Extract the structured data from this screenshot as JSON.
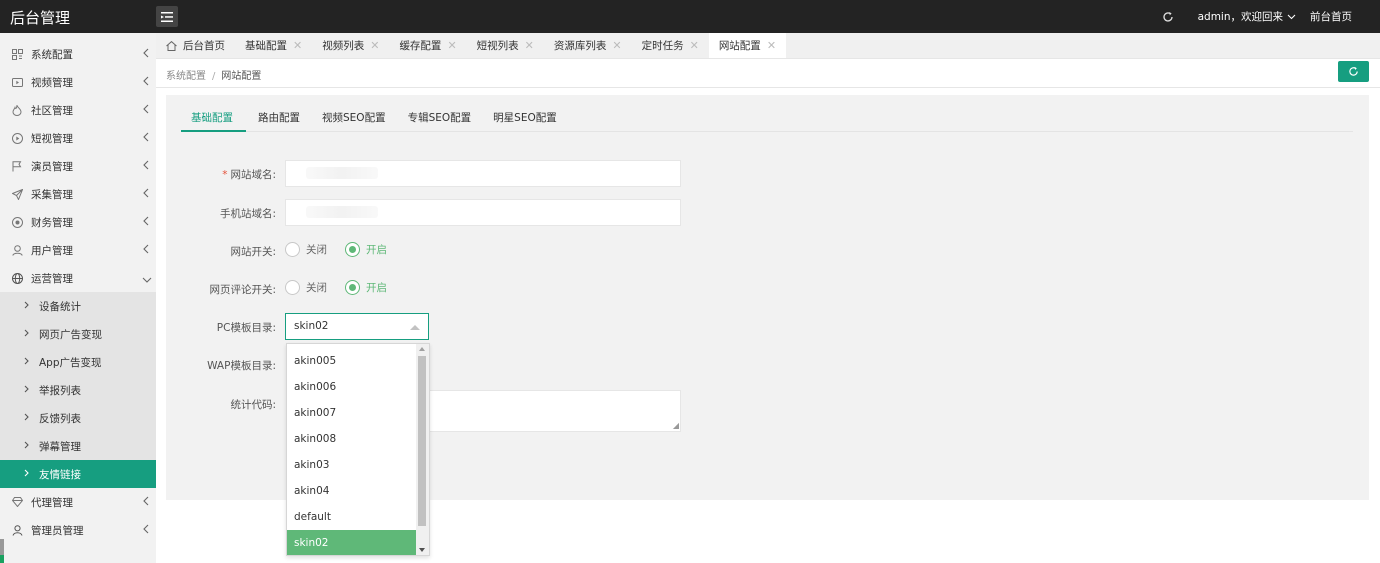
{
  "header": {
    "brand": "后台管理",
    "admin_text": "admin，欢迎回来",
    "front_link": "前台首页"
  },
  "sidebar": {
    "items": [
      {
        "label": "系统配置",
        "icon": "config-icon"
      },
      {
        "label": "视频管理",
        "icon": "video-icon"
      },
      {
        "label": "社区管理",
        "icon": "fire-icon"
      },
      {
        "label": "短视管理",
        "icon": "play-circle-icon"
      },
      {
        "label": "演员管理",
        "icon": "flag-icon"
      },
      {
        "label": "采集管理",
        "icon": "send-icon"
      },
      {
        "label": "财务管理",
        "icon": "finance-icon"
      },
      {
        "label": "用户管理",
        "icon": "user-icon"
      },
      {
        "label": "运营管理",
        "icon": "globe-icon"
      }
    ],
    "sub_items": [
      {
        "label": "设备统计"
      },
      {
        "label": "网页广告变现"
      },
      {
        "label": "App广告变现"
      },
      {
        "label": "举报列表"
      },
      {
        "label": "反馈列表"
      },
      {
        "label": "弹幕管理"
      },
      {
        "label": "友情链接"
      }
    ],
    "bottom_items": [
      {
        "label": "代理管理",
        "icon": "diamond-icon"
      },
      {
        "label": "管理员管理",
        "icon": "person-icon"
      }
    ],
    "accent_color": "#169e80"
  },
  "page_tabs": [
    {
      "label": "后台首页"
    },
    {
      "label": "基础配置"
    },
    {
      "label": "视频列表"
    },
    {
      "label": "缓存配置"
    },
    {
      "label": "短视列表"
    },
    {
      "label": "资源库列表"
    },
    {
      "label": "定时任务"
    },
    {
      "label": "网站配置"
    }
  ],
  "breadcrumb": {
    "parent": "系统配置",
    "separator": "/",
    "current": "网站配置"
  },
  "config_tabs": [
    {
      "label": "基础配置"
    },
    {
      "label": "路由配置"
    },
    {
      "label": "视频SEO配置"
    },
    {
      "label": "专辑SEO配置"
    },
    {
      "label": "明星SEO配置"
    }
  ],
  "form": {
    "domain_label": "网站域名:",
    "required_mark": "*",
    "mobile_domain_label": "手机站域名:",
    "site_switch_label": "网站开关:",
    "comment_switch_label": "网页评论开关:",
    "option_off": "关闭",
    "option_on": "开启",
    "pc_template_label": "PC模板目录:",
    "pc_template_value": "skin02",
    "wap_template_label": "WAP模板目录:",
    "stats_code_label": "统计代码:"
  },
  "dropdown_options": [
    {
      "label": "akin005"
    },
    {
      "label": "akin006"
    },
    {
      "label": "akin007"
    },
    {
      "label": "akin008"
    },
    {
      "label": "akin03"
    },
    {
      "label": "akin04"
    },
    {
      "label": "default"
    },
    {
      "label": "skin02"
    }
  ],
  "colors": {
    "header_bg": "#232323",
    "accent": "#169e80",
    "radio_checked": "#5fb878",
    "selected_option_bg": "#5fb878"
  }
}
